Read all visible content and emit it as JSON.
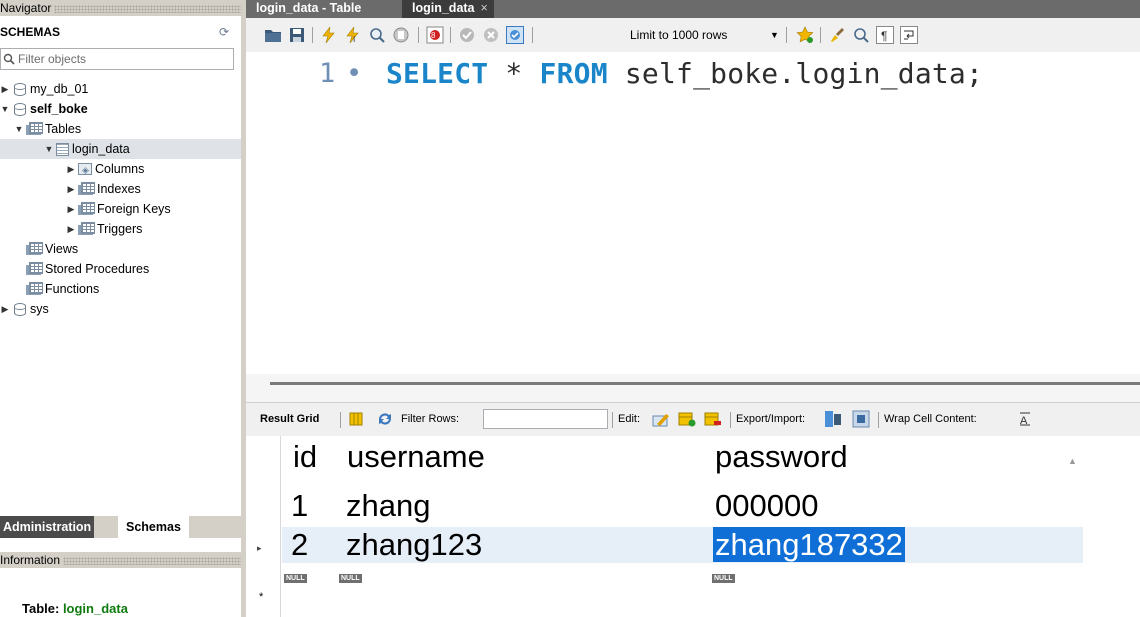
{
  "navigator": {
    "header": "Navigator",
    "schemas_title": "SCHEMAS",
    "filter_placeholder": "Filter objects",
    "tree": {
      "db1": "my_db_01",
      "db2": "self_boke",
      "tables": "Tables",
      "table": "login_data",
      "columns": "Columns",
      "indexes": "Indexes",
      "foreign_keys": "Foreign Keys",
      "triggers": "Triggers",
      "views": "Views",
      "stored_procedures": "Stored Procedures",
      "functions": "Functions",
      "db3": "sys"
    },
    "tabs": {
      "administration": "Administration",
      "schemas": "Schemas"
    },
    "information_header": "Information",
    "info_table_prefix": "Table: ",
    "info_table_name": "login_data"
  },
  "tabs": {
    "first": "login_data - Table",
    "second": "login_data",
    "close": "×"
  },
  "toolbar": {
    "limit": "Limit to 1000 rows"
  },
  "editor": {
    "line_number": "1",
    "line_marker": "•",
    "kw_select": "SELECT",
    "star": "*",
    "kw_from": "FROM",
    "target": "self_boke.login_data;"
  },
  "result_toolbar": {
    "result_grid": "Result Grid",
    "filter_rows": "Filter Rows:",
    "edit": "Edit:",
    "export_import": "Export/Import:",
    "wrap_cell": "Wrap Cell Content:"
  },
  "grid": {
    "columns": [
      "id",
      "username",
      "password"
    ],
    "rows": [
      [
        "1",
        "zhang",
        "000000"
      ],
      [
        "2",
        "zhang123",
        "zhang187332"
      ]
    ],
    "null_label": "NULL",
    "new_row_marker": "*",
    "current_row_marker": "▸"
  },
  "colors": {
    "keyword": "#1a86c9",
    "selection": "#0f6fd6",
    "tab_active": "#3c3c3c"
  }
}
